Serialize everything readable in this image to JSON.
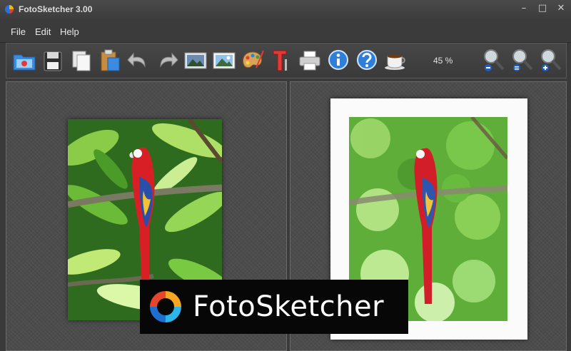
{
  "window": {
    "title": "FotoSketcher 3.00"
  },
  "menu": {
    "file": "File",
    "edit": "Edit",
    "help": "Help"
  },
  "toolbar": {
    "zoom_level": "45 %",
    "buttons": [
      "open-icon",
      "save-icon",
      "copy-icon",
      "paste-icon",
      "undo-icon",
      "redo-icon",
      "original-image-icon",
      "result-image-icon",
      "palette-icon",
      "text-icon",
      "print-icon",
      "info-icon",
      "help-icon",
      "coffee-icon",
      "zoom-out-icon",
      "zoom-fit-icon",
      "zoom-in-icon"
    ]
  },
  "brand": {
    "text": "FotoSketcher"
  },
  "colors": {
    "background": "#3a3a3a",
    "pane": "#4a4a4a",
    "parrot_red": "#d81f26",
    "leaf_green": "#3fa02a"
  }
}
